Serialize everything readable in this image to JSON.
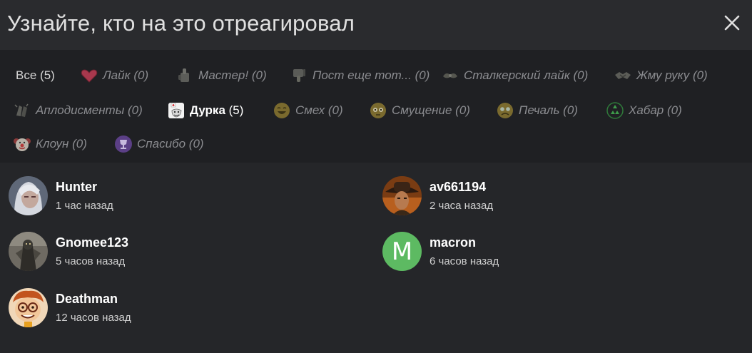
{
  "modal": {
    "title": "Узнайте, кто на это отреагировал",
    "close_icon": "close-icon"
  },
  "filters": [
    {
      "label": "Все",
      "count": "(5)",
      "icon": "",
      "state": "normal"
    },
    {
      "label": "Лайк",
      "count": "(0)",
      "icon": "heart-icon",
      "state": "dimmed"
    },
    {
      "label": "Мастер!",
      "count": "(0)",
      "icon": "master-icon",
      "state": "dimmed"
    },
    {
      "label": "Пост еще тот...",
      "count": "(0)",
      "icon": "thumbs-down-icon",
      "state": "dimmed"
    },
    {
      "label": "Сталкерский лайк",
      "count": "(0)",
      "icon": "stalker-like-icon",
      "state": "dimmed"
    },
    {
      "label": "Жму руку",
      "count": "(0)",
      "icon": "handshake-icon",
      "state": "dimmed"
    },
    {
      "label": "Аплодисменты",
      "count": "(0)",
      "icon": "applause-icon",
      "state": "dimmed"
    },
    {
      "label": "Дурка",
      "count": "(5)",
      "icon": "durka-icon",
      "state": "active"
    },
    {
      "label": "Смех",
      "count": "(0)",
      "icon": "laugh-icon",
      "state": "dimmed"
    },
    {
      "label": "Смущение",
      "count": "(0)",
      "icon": "embarrassed-icon",
      "state": "dimmed"
    },
    {
      "label": "Печаль",
      "count": "(0)",
      "icon": "sad-icon",
      "state": "dimmed"
    },
    {
      "label": "Хабар",
      "count": "(0)",
      "icon": "khabar-icon",
      "state": "dimmed"
    },
    {
      "label": "Клоун",
      "count": "(0)",
      "icon": "clown-icon",
      "state": "dimmed"
    },
    {
      "label": "Спасибо",
      "count": "(0)",
      "icon": "trophy-icon",
      "state": "dimmed"
    }
  ],
  "users": [
    {
      "name": "Hunter",
      "time": "1 час назад",
      "avatar": "photo-avatar-white-hair"
    },
    {
      "name": "av661194",
      "time": "2 часа назад",
      "avatar": "photo-avatar-cowboy-hat"
    },
    {
      "name": "Gnomee123",
      "time": "5 часов назад",
      "avatar": "photo-avatar-armored-figure"
    },
    {
      "name": "macron",
      "time": "6 часов назад",
      "avatar": "letter-avatar",
      "avatar_letter": "M",
      "avatar_color": "#5dba62"
    },
    {
      "name": "Deathman",
      "time": "12 часов назад",
      "avatar": "cartoon-avatar-red-hair"
    }
  ],
  "colors": {
    "background": "#252629",
    "filter_bar": "#1f2023",
    "dimmed_text": "#8b8c90",
    "active_text": "#ffffff",
    "macron_avatar": "#5dba62"
  }
}
